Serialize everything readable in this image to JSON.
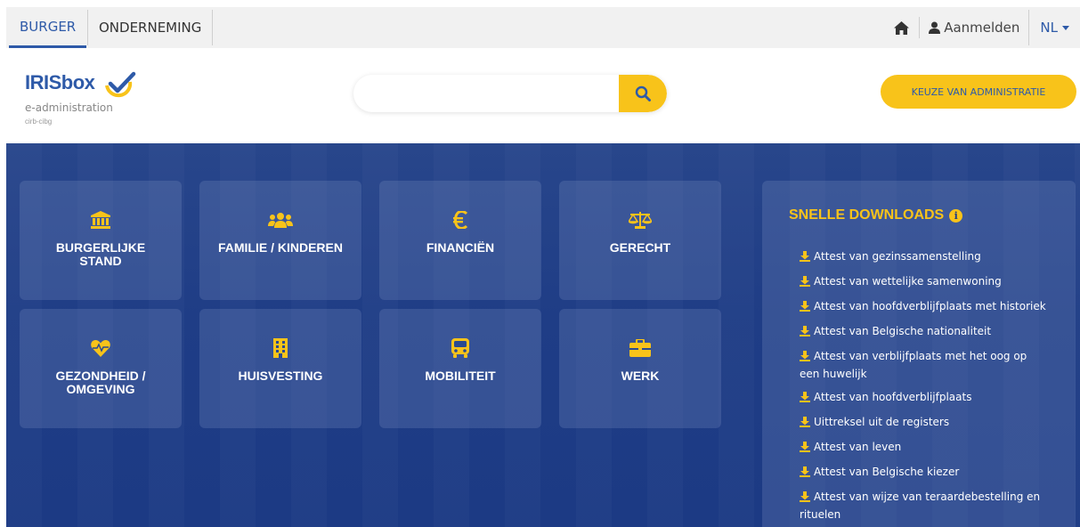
{
  "topbar": {
    "tabs": [
      {
        "label": "BURGER",
        "active": true
      },
      {
        "label": "ONDERNEMING",
        "active": false
      }
    ],
    "login_label": "Aanmelden",
    "language": "NL"
  },
  "header": {
    "logo_title": "IRISbox",
    "logo_subtitle": "e-administration",
    "logo_org": "cirb-cibg",
    "search_placeholder": "",
    "admin_button_label": "KEUZE VAN ADMINISTRATIE"
  },
  "categories": [
    {
      "label": "BURGERLIJKE STAND",
      "icon": "bank-icon"
    },
    {
      "label": "FAMILIE / KINDEREN",
      "icon": "family-icon"
    },
    {
      "label": "FINANCIËN",
      "icon": "euro-icon"
    },
    {
      "label": "GERECHT",
      "icon": "scales-icon"
    },
    {
      "label": "GEZONDHEID / OMGEVING",
      "icon": "heartbeat-icon"
    },
    {
      "label": "HUISVESTING",
      "icon": "building-icon"
    },
    {
      "label": "MOBILITEIT",
      "icon": "bus-icon"
    },
    {
      "label": "WERK",
      "icon": "briefcase-icon"
    }
  ],
  "downloads": {
    "title": "SNELLE DOWNLOADS",
    "items": [
      "Attest van gezinssamenstelling",
      "Attest van wettelijke samenwoning",
      "Attest van hoofdverblijfplaats met historiek",
      "Attest van Belgische nationaliteit",
      "Attest van verblijfplaats met het oog op een huwelijk",
      "Attest van hoofdverblijfplaats",
      "Uittreksel uit de registers",
      "Attest van leven",
      "Attest van Belgische kiezer",
      "Attest van wijze van teraardebestelling en rituelen"
    ]
  },
  "colors": {
    "primary_blue": "#2e5aa8",
    "accent_yellow": "#f8c31a",
    "hero_blue": "#1f3d86"
  }
}
